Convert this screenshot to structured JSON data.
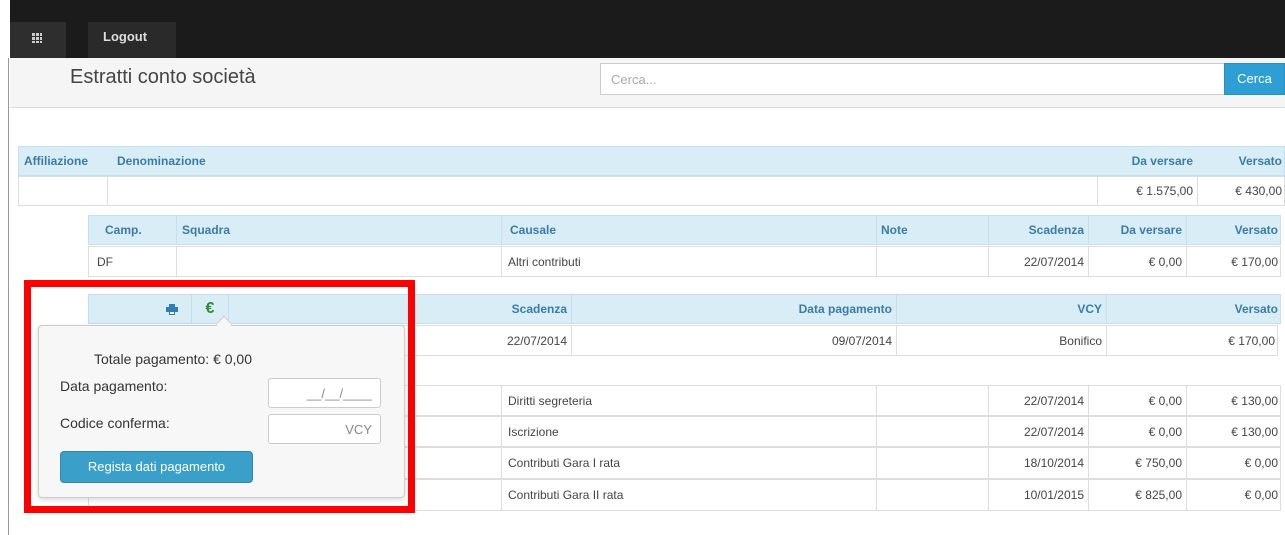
{
  "navbar": {
    "logout_label": "Logout",
    "apps_icon": "grid-icon"
  },
  "header": {
    "title": "Estratti conto società",
    "search_placeholder": "Cerca...",
    "search_button": "Cerca"
  },
  "main_table": {
    "headers": {
      "affiliazione": "Affiliazione",
      "denominazione": "Denominazione",
      "da_versare": "Da versare",
      "versato": "Versato"
    },
    "row": {
      "affiliazione": "",
      "denominazione": "",
      "da_versare": "€ 1.575,00",
      "versato": "€ 430,00"
    }
  },
  "detail_table": {
    "headers": {
      "camp": "Camp.",
      "squadra": "Squadra",
      "causale": "Causale",
      "note": "Note",
      "scadenza": "Scadenza",
      "da_versare": "Da versare",
      "versato": "Versato"
    },
    "rows": [
      {
        "camp": "DF",
        "squadra": "",
        "causale": "Altri contributi",
        "note": "",
        "scadenza": "22/07/2014",
        "da_versare": "€ 0,00",
        "versato": "€ 170,00"
      },
      {
        "camp": "",
        "squadra": "",
        "causale": "Diritti segreteria",
        "note": "",
        "scadenza": "22/07/2014",
        "da_versare": "€ 0,00",
        "versato": "€ 130,00"
      },
      {
        "camp": "",
        "squadra": "",
        "causale": "Iscrizione",
        "note": "",
        "scadenza": "22/07/2014",
        "da_versare": "€ 0,00",
        "versato": "€ 130,00"
      },
      {
        "camp": "",
        "squadra": "",
        "causale": "Contributi Gara I rata",
        "note": "",
        "scadenza": "18/10/2014",
        "da_versare": "€ 750,00",
        "versato": "€ 0,00"
      },
      {
        "camp": "",
        "squadra": "",
        "causale": "Contributi Gara II rata",
        "note": "",
        "scadenza": "10/01/2015",
        "da_versare": "€ 825,00",
        "versato": "€ 0,00"
      }
    ]
  },
  "payment_table": {
    "headers": {
      "scadenza": "Scadenza",
      "data_pagamento": "Data pagamento",
      "vcy": "VCY",
      "versato": "Versato"
    },
    "row": {
      "scadenza": "22/07/2014",
      "data_pagamento": "09/07/2014",
      "vcy": "Bonifico",
      "versato": "€ 170,00"
    },
    "print_icon": "print-icon",
    "euro_glyph": "€"
  },
  "popover": {
    "total_label": "Totale pagamento: € 0,00",
    "date_label": "Data pagamento:",
    "date_placeholder": "__/__/____",
    "code_label": "Codice conferma:",
    "code_placeholder": "VCY",
    "submit_label": "Regista dati pagamento"
  },
  "colors": {
    "highlight_box": "#ff0000",
    "table_header_bg": "#d9edf7",
    "table_header_text": "#3a7ca5",
    "primary_button": "#3aa0c9",
    "euro_green": "#2e8b2e"
  }
}
